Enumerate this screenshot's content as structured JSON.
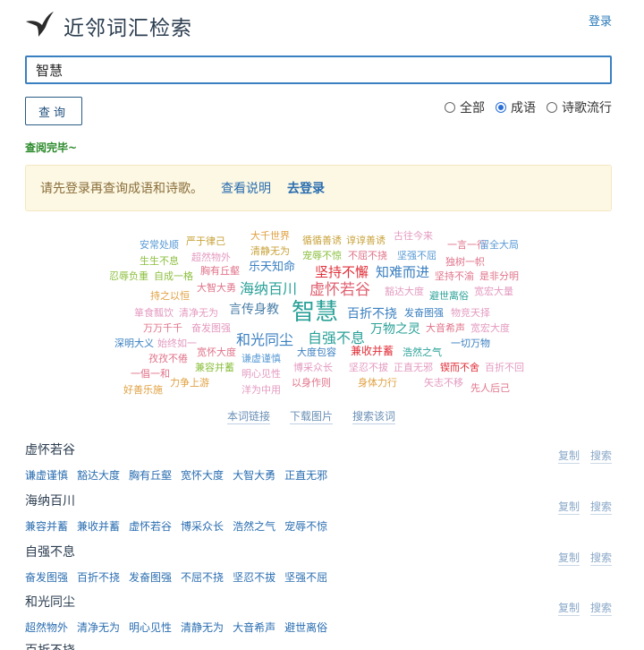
{
  "header": {
    "title": "近邻词汇检索",
    "login": "登录"
  },
  "search": {
    "value": "智慧"
  },
  "query_button": "查询",
  "modes": [
    {
      "label": "全部",
      "checked": false
    },
    {
      "label": "成语",
      "checked": true
    },
    {
      "label": "诗歌流行",
      "checked": false
    }
  ],
  "status": "查阅完毕~",
  "notice": {
    "text": "请先登录再查询成语和诗歌。",
    "help_link": "查看说明",
    "login_link": "去登录"
  },
  "cloud": {
    "words": [
      "安常处顺",
      "严于律己",
      "超然物外",
      "生生不息",
      "自成一格",
      "胸有丘壑",
      "忍辱负重",
      "持之以恒",
      "大智大勇",
      "乐天知命",
      "大千世界",
      "清静无为",
      "循循善诱",
      "谆谆善诱",
      "古往今来",
      "一言一行",
      "留全大局",
      "宠辱不惊",
      "不屈不挠",
      "坚强不屈",
      "独树一帜",
      "坚持不懈",
      "知难而进",
      "坚持不渝",
      "是非分明",
      "海纳百川",
      "虚怀若谷",
      "豁达大度",
      "避世离俗",
      "宽宏大量",
      "言传身教",
      "智慧",
      "百折不挠",
      "发奋图强",
      "物竞天择",
      "箪食瓢饮",
      "清净无为",
      "万万千千",
      "奋发图强",
      "万物之灵",
      "大音希声",
      "宽宏大度",
      "深明大义",
      "始终如一",
      "和光同尘",
      "自强不息",
      "一切万物",
      "孜孜不倦",
      "宽怀大度",
      "谦虚谨慎",
      "大度包容",
      "兼收并蓄",
      "浩然之气",
      "一倡一和",
      "兼容并蓄",
      "明心见性",
      "博采众长",
      "坚忍不拔",
      "正直无邪",
      "锲而不舍",
      "百折不回",
      "好善乐施",
      "力争上游",
      "洋为中用",
      "以身作则",
      "身体力行",
      "矢志不移",
      "先人后己"
    ],
    "links": {
      "link": "本词链接",
      "download": "下载图片",
      "search": "搜索该词"
    }
  },
  "results": [
    {
      "title": "虚怀若谷",
      "synonyms": [
        "谦虚谨慎",
        "豁达大度",
        "胸有丘壑",
        "宽怀大度",
        "大智大勇",
        "正直无邪"
      ]
    },
    {
      "title": "海纳百川",
      "synonyms": [
        "兼容并蓄",
        "兼收并蓄",
        "虚怀若谷",
        "博采众长",
        "浩然之气",
        "宠辱不惊"
      ]
    },
    {
      "title": "自强不息",
      "synonyms": [
        "奋发图强",
        "百折不挠",
        "发奋图强",
        "不屈不挠",
        "坚忍不拔",
        "坚强不屈"
      ]
    },
    {
      "title": "和光同尘",
      "synonyms": [
        "超然物外",
        "清净无为",
        "明心见性",
        "清静无为",
        "大音希声",
        "避世离俗"
      ]
    },
    {
      "title": "百折不挠",
      "synonyms": []
    }
  ],
  "result_actions": {
    "copy": "复制",
    "search": "搜索"
  }
}
